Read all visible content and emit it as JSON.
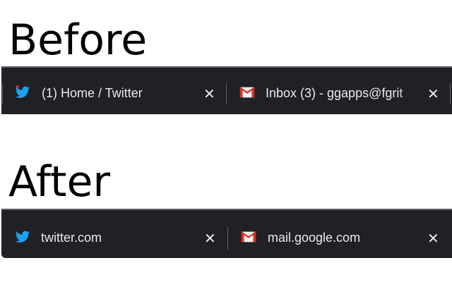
{
  "before": {
    "heading": "Before",
    "tabs": [
      {
        "title": "(1) Home / Twitter",
        "icon": "twitter-icon"
      },
      {
        "title": "Inbox (3) - ggapps@fgrit",
        "icon": "gmail-icon"
      }
    ]
  },
  "after": {
    "heading": "After",
    "tabs": [
      {
        "title": "twitter.com",
        "icon": "twitter-icon"
      },
      {
        "title": "mail.google.com",
        "icon": "gmail-icon"
      }
    ]
  },
  "colors": {
    "bar": "#202124",
    "twitter": "#1da1f2",
    "gmail": "#d93025",
    "notification_dot": "#e0245e"
  }
}
